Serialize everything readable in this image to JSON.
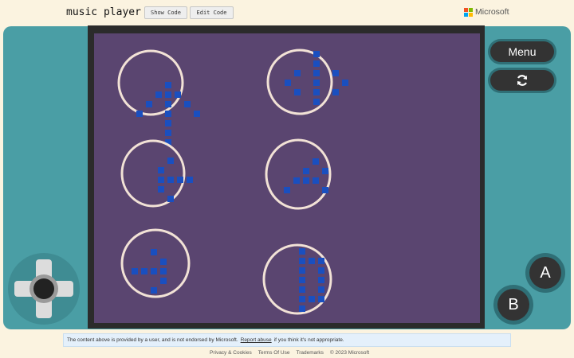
{
  "header": {
    "title": "music player",
    "show_code_label": "Show Code",
    "edit_code_label": "Edit Code",
    "brand": "Microsoft"
  },
  "controls": {
    "menu_label": "Menu",
    "restart_icon": "restart-icon",
    "a_label": "A",
    "b_label": "B",
    "dpad_icon": "dpad-icon"
  },
  "screen": {
    "background": "#5a4570",
    "ring_color": "#f2e2d6",
    "note_color": "#1a4fbf",
    "sprites": [
      {
        "id": "note-1",
        "pixels": [
          [
            4,
            1
          ],
          [
            3,
            2
          ],
          [
            4,
            2
          ],
          [
            5,
            2
          ],
          [
            2,
            3
          ],
          [
            4,
            3
          ],
          [
            6,
            3
          ],
          [
            1,
            4
          ],
          [
            4,
            4
          ],
          [
            7,
            4
          ],
          [
            4,
            5
          ],
          [
            4,
            6
          ],
          [
            4,
            7
          ]
        ]
      },
      {
        "id": "note-2",
        "pixels": [
          [
            4,
            0
          ],
          [
            4,
            1
          ],
          [
            2,
            2
          ],
          [
            4,
            2
          ],
          [
            6,
            2
          ],
          [
            1,
            3
          ],
          [
            4,
            3
          ],
          [
            7,
            3
          ],
          [
            2,
            4
          ],
          [
            4,
            4
          ],
          [
            6,
            4
          ],
          [
            4,
            5
          ]
        ]
      },
      {
        "id": "note-3",
        "pixels": [
          [
            4,
            1
          ],
          [
            3,
            2
          ],
          [
            3,
            3
          ],
          [
            4,
            3
          ],
          [
            5,
            3
          ],
          [
            6,
            3
          ],
          [
            3,
            4
          ],
          [
            4,
            5
          ]
        ]
      },
      {
        "id": "note-4",
        "pixels": [
          [
            4,
            1
          ],
          [
            3,
            2
          ],
          [
            5,
            2
          ],
          [
            2,
            3
          ],
          [
            3,
            3
          ],
          [
            4,
            3
          ],
          [
            1,
            4
          ],
          [
            5,
            4
          ]
        ]
      },
      {
        "id": "note-5",
        "pixels": [
          [
            3,
            1
          ],
          [
            4,
            2
          ],
          [
            1,
            3
          ],
          [
            2,
            3
          ],
          [
            3,
            3
          ],
          [
            4,
            3
          ],
          [
            4,
            4
          ],
          [
            3,
            5
          ]
        ]
      },
      {
        "id": "note-6",
        "pixels": [
          [
            2,
            0
          ],
          [
            2,
            1
          ],
          [
            3,
            1
          ],
          [
            4,
            1
          ],
          [
            2,
            2
          ],
          [
            4,
            2
          ],
          [
            2,
            3
          ],
          [
            4,
            3
          ],
          [
            2,
            4
          ],
          [
            4,
            4
          ],
          [
            2,
            5
          ],
          [
            3,
            5
          ],
          [
            4,
            5
          ],
          [
            2,
            6
          ]
        ]
      }
    ]
  },
  "notice": {
    "text_before": "The content above is provided by a user, and is not endorsed by Microsoft.",
    "link": "Report abuse",
    "text_after": "if you think it's not appropriate."
  },
  "footer": {
    "privacy": "Privacy & Cookies",
    "terms": "Terms Of Use",
    "trademarks": "Trademarks",
    "copyright": "© 2023 Microsoft"
  }
}
